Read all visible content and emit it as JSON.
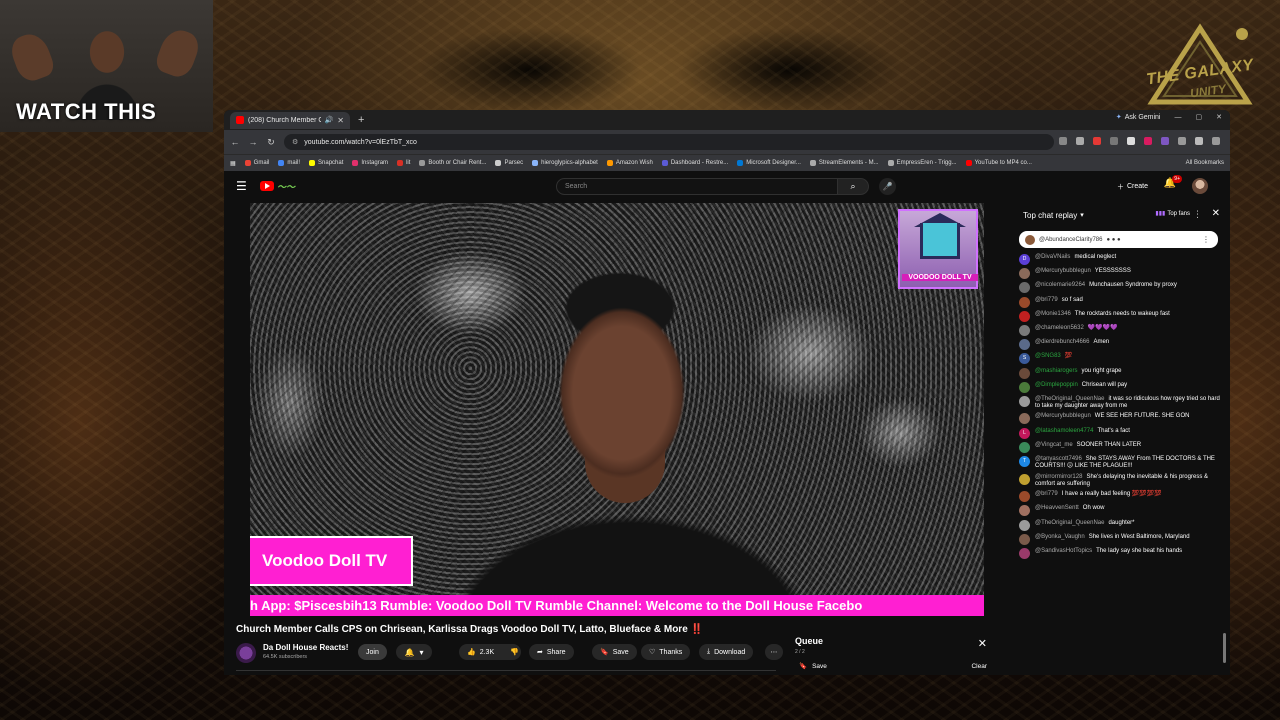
{
  "overlay": {
    "watch_title": "WATCH THIS",
    "logo_text": "THE GALAXY",
    "logo_sub": "UNITY"
  },
  "browser": {
    "tab_title": "(208) Church Member Calls",
    "new_tab": "+",
    "ask_gemini": "Ask Gemini",
    "url": "youtube.com/watch?v=0lEzTbT_xco",
    "bookmarks": [
      {
        "label": "Gmail",
        "color": "#ea4335"
      },
      {
        "label": "mail!",
        "color": "#4285f4"
      },
      {
        "label": "Snapchat",
        "color": "#fffc00"
      },
      {
        "label": "Instagram",
        "color": "#e1306c"
      },
      {
        "label": "lit",
        "color": "#d93025"
      },
      {
        "label": "Booth or Chair Rent...",
        "color": "#999999"
      },
      {
        "label": "Parsec",
        "color": "#cccccc"
      },
      {
        "label": "hieroglypics-alphabet",
        "color": "#8ab4f8"
      },
      {
        "label": "Amazon Wish",
        "color": "#ff9900"
      },
      {
        "label": "Dashboard - Restre...",
        "color": "#5b5bd6"
      },
      {
        "label": "Microsoft Designer...",
        "color": "#0078d4"
      },
      {
        "label": "StreamElements - M...",
        "color": "#aaaaaa"
      },
      {
        "label": "EmpressEren - Trigg...",
        "color": "#aaaaaa"
      },
      {
        "label": "YouTube to MP4 co...",
        "color": "#ff0000"
      }
    ],
    "all_bookmarks": "All Bookmarks"
  },
  "youtube": {
    "search_placeholder": "Search",
    "create_label": "Create",
    "notif_count": "9+",
    "video": {
      "lower_third": "Voodoo Doll TV",
      "ticker": "h App: $Piscesbih13 Rumble: Voodoo Doll TV Rumble Channel: Welcome to the Doll House Facebo",
      "badge_text": "VOODOO DOLL TV"
    },
    "title": "Church Member Calls CPS on Chrisean, Karlissa Drags Voodoo Doll TV, Latto, Blueface & More",
    "title_suffix": "‼️",
    "channel": {
      "name": "Da Doll House Reacts!",
      "subs": "64.5K subscribers",
      "join": "Join"
    },
    "actions": {
      "likes": "2.3K",
      "share": "Share",
      "save": "Save",
      "thanks": "Thanks",
      "download": "Download"
    },
    "queue": {
      "title": "Queue",
      "count": "2 / 2",
      "save": "Save",
      "clear": "Clear"
    }
  },
  "chat": {
    "header": "Top chat replay",
    "top_fans": "Top fans",
    "pinned_user": "@AbundanceClarity786",
    "messages": [
      {
        "user": "@DivaVNails",
        "text": "medical neglect",
        "initial": "D",
        "color": "#5b3fd6",
        "green": false
      },
      {
        "user": "@Mercurybubblegun",
        "text": "YESSSSSSS",
        "initial": "",
        "color": "#8a6a5a",
        "green": false
      },
      {
        "user": "@nicolemarie9264",
        "text": "Munchausen Syndrome by proxy",
        "initial": "",
        "color": "#6a6a6a",
        "green": false
      },
      {
        "user": "@bri779",
        "text": "so f sad",
        "initial": "",
        "color": "#9a4a2a",
        "green": false
      },
      {
        "user": "@Monie1346",
        "text": "The rocktards needs to wakeup fast",
        "initial": "",
        "color": "#c02020",
        "green": false
      },
      {
        "user": "@chameleon5632",
        "text": "💜💜💜💜",
        "initial": "",
        "color": "#7a7a7a",
        "green": false
      },
      {
        "user": "@dierdrebunch4666",
        "text": "Amen",
        "initial": "",
        "color": "#5a6a8a",
        "green": false
      },
      {
        "user": "@SNG83",
        "text": "💯",
        "initial": "S",
        "color": "#3a5a9a",
        "green": true
      },
      {
        "user": "@mashiarogers",
        "text": "you right grape",
        "initial": "",
        "color": "#6a4a3a",
        "green": true
      },
      {
        "user": "@Dimplepoppin",
        "text": "Chrisean will pay",
        "initial": "",
        "color": "#4a7a3a",
        "green": true
      },
      {
        "user": "@TheOriginal_QueenNae",
        "text": "it was so ridiculous how rgey tried so hard to take my daughter away from me",
        "initial": "",
        "color": "#9a9a9a",
        "green": false
      },
      {
        "user": "@Mercurybubblegun",
        "text": "WE SEE HER FUTURE. SHE GON",
        "initial": "",
        "color": "#8a6a5a",
        "green": false
      },
      {
        "user": "@latashamoleen4774",
        "text": "That's a fact",
        "initial": "L",
        "color": "#c2185b",
        "green": true
      },
      {
        "user": "@Vingcat_me",
        "text": "SOONER THAN LATER",
        "initial": "",
        "color": "#3a8a5a",
        "green": false
      },
      {
        "user": "@tanyascott7496",
        "text": "She STAYS AWAY From THE DOCTORS & THE COURTS!!! 😕 LIKE THE PLAGUE!!!",
        "initial": "T",
        "color": "#1e88e5",
        "green": false
      },
      {
        "user": "@mirrormirror128",
        "text": "She's delaying the inevitable & his progress & comfort are suffering",
        "initial": "",
        "color": "#c0a030",
        "green": false
      },
      {
        "user": "@bri779",
        "text": "I have a really bad feeling 💯💯💯💯",
        "initial": "",
        "color": "#9a4a2a",
        "green": false
      },
      {
        "user": "@HeavvenSentt",
        "text": "Oh wow",
        "initial": "",
        "color": "#a07060",
        "green": false
      },
      {
        "user": "@TheOriginal_QueenNae",
        "text": "daughter*",
        "initial": "",
        "color": "#9a9a9a",
        "green": false
      },
      {
        "user": "@Byonka_Vaughn",
        "text": "She lives in West Baltimore, Maryland",
        "initial": "",
        "color": "#7a5a4a",
        "green": false
      },
      {
        "user": "@SandivasHotTopics",
        "text": "The lady say she beat his hands",
        "initial": "",
        "color": "#9a3a6a",
        "green": false
      }
    ]
  }
}
